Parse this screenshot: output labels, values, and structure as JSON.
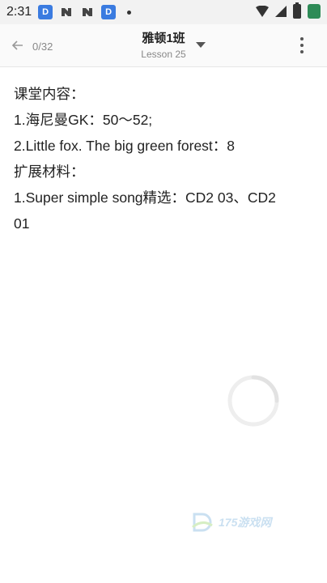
{
  "statusbar": {
    "time": "2:31",
    "app_letter": "D"
  },
  "header": {
    "page_counter": "0/32",
    "title": "雅顿1班",
    "subtitle": "Lesson 25"
  },
  "content": {
    "lines": [
      "课堂内容：",
      "1.海尼曼GK：50～52;",
      "2.Little fox. The big green forest：8",
      "扩展材料：",
      "1.Super simple song精选：CD2 03、CD2",
      "01"
    ]
  },
  "watermark": {
    "text": "175游戏网"
  }
}
